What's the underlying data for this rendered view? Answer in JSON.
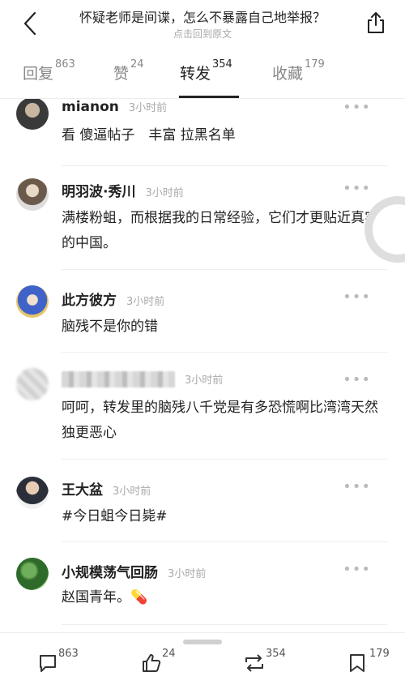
{
  "header": {
    "title": "怀疑老师是间谍，怎么不暴露自己地举报？",
    "subtitle": "点击回到原文"
  },
  "tabs": [
    {
      "label": "回复",
      "count": "863"
    },
    {
      "label": "赞",
      "count": "24"
    },
    {
      "label": "转发",
      "count": "354",
      "active": true
    },
    {
      "label": "收藏",
      "count": "179"
    }
  ],
  "comments": [
    {
      "name": "mianon",
      "time": "3小时前",
      "content": "看 傻逼帖子　丰富 拉黑名单"
    },
    {
      "name": "明羽波·秀川",
      "time": "3小时前",
      "content": "满楼粉蛆，而根据我的日常经验，它们才更贴近真实的中国。"
    },
    {
      "name": "此方彼方",
      "time": "3小时前",
      "content": "脑残不是你的错"
    },
    {
      "name": "",
      "time": "3小时前",
      "content": "呵呵，转发里的脑残八千党是有多恐慌啊比湾湾天然独更恶心"
    },
    {
      "name": "王大盆",
      "time": "3小时前",
      "content": "#今日蛆今日毙#"
    },
    {
      "name": "小规模荡气回肠",
      "time": "3小时前",
      "content": "赵国青年。💊"
    }
  ],
  "more_label": "•••",
  "bottombar": {
    "comment_count": "863",
    "like_count": "24",
    "repost_count": "354",
    "favorite_count": "179"
  }
}
